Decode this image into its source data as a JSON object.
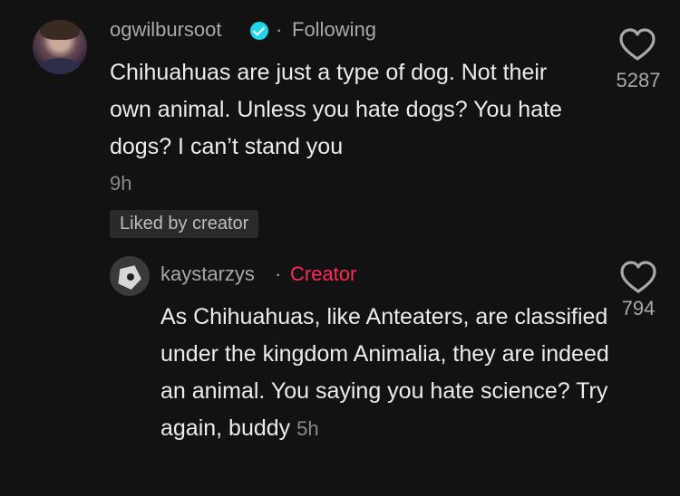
{
  "comment": {
    "username": "ogwilbursoot",
    "separator": "·",
    "following_label": "Following",
    "text": "Chihuahuas are just a type of dog. Not their own animal. Unless you hate dogs? You hate dogs? I can’t stand you",
    "time": "9h",
    "liked_by_creator": "Liked by creator",
    "like_count": "5287"
  },
  "reply": {
    "username": "kaystarzys",
    "separator": "·",
    "creator_label": "Creator",
    "text": "As Chihuahuas, like Anteaters, are classified under the kingdom Animalia, they are indeed an animal. You saying you hate science? Try again, buddy",
    "time": "5h",
    "like_count": "794"
  },
  "colors": {
    "background": "#121212",
    "creator": "#fe2c55",
    "verified": "#20d5ec"
  }
}
